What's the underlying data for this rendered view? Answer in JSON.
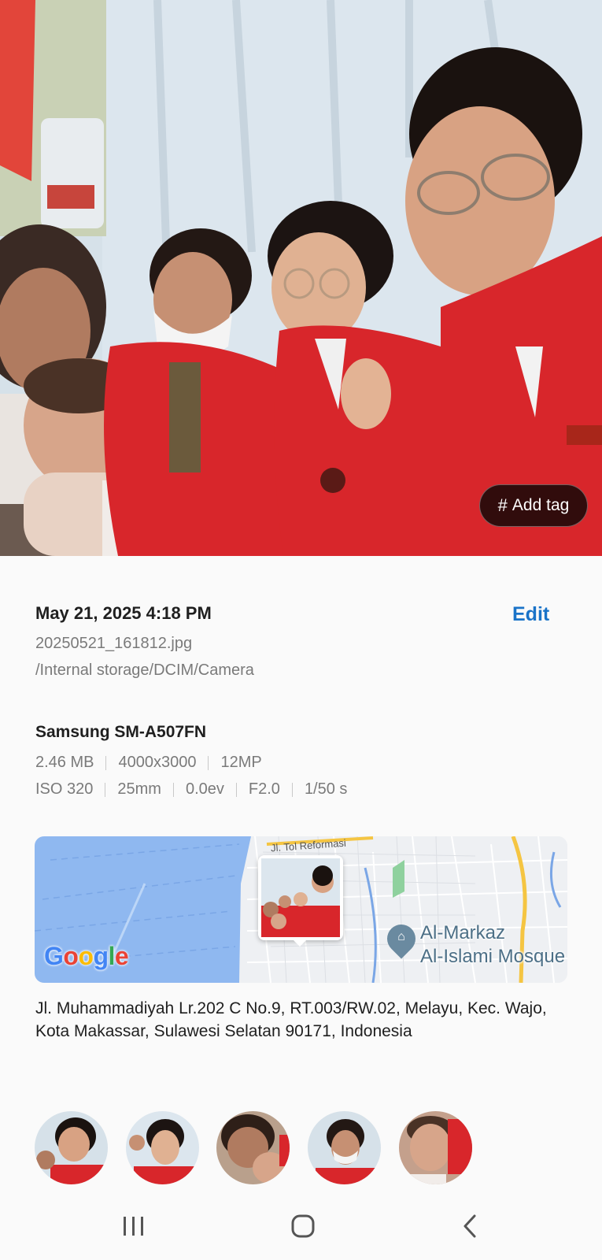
{
  "photo": {
    "add_tag_label": "Add tag",
    "add_tag_icon": "hash-icon"
  },
  "details": {
    "datetime": "May 21, 2025 4:18 PM",
    "edit_label": "Edit",
    "filename": "20250521_161812.jpg",
    "path": "/Internal storage/DCIM/Camera"
  },
  "camera": {
    "device": "Samsung SM-A507FN",
    "file_size": "2.46 MB",
    "resolution": "4000x3000",
    "megapixels": "12MP",
    "iso": "ISO 320",
    "focal_length": "25mm",
    "exposure_value": "0.0ev",
    "aperture": "F2.0",
    "shutter": "1/50 s"
  },
  "map": {
    "road_label": "Jl. Tol Reformasi",
    "poi_line1": "Al-Markaz",
    "poi_line2": "Al-Islami Mosque",
    "provider": "Google",
    "colors": {
      "water": "#8fb8f0",
      "land": "#eef0f3",
      "highway": "#f5c542"
    }
  },
  "location": {
    "address": "Jl. Muhammadiyah Lr.202 C No.9, RT.003/RW.02, Melayu, Kec. Wajo, Kota Makassar, Sulawesi Selatan 90171, Indonesia"
  },
  "faces": {
    "count": 5,
    "items": [
      "face-1",
      "face-2",
      "face-3",
      "face-4",
      "face-5"
    ]
  },
  "navbar": {
    "recent_icon": "recent-apps-icon",
    "home_icon": "home-icon",
    "back_icon": "back-icon"
  },
  "theme": {
    "accent": "#1a73c8",
    "secondary_text": "#7a7a7a",
    "jacket_red": "#d8262b"
  }
}
